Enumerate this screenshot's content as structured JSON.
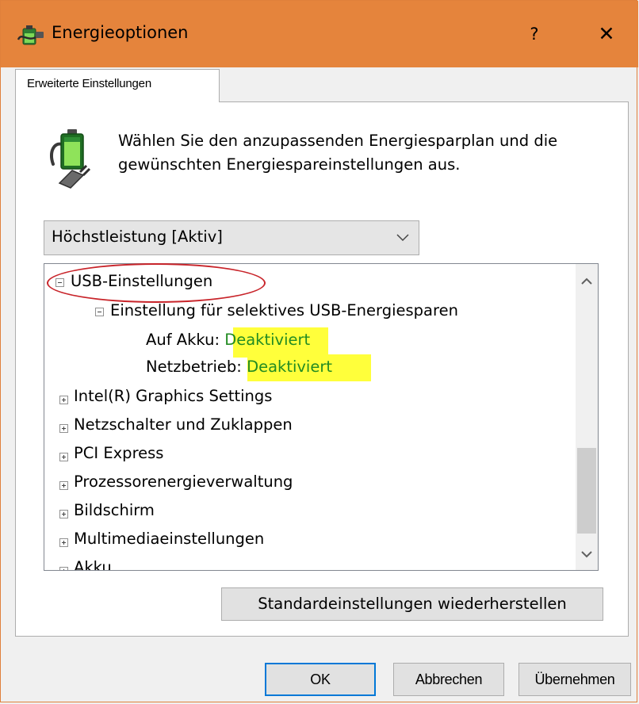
{
  "window": {
    "title": "Energieoptionen",
    "help_label": "?",
    "close_label": "✕",
    "title_bar_color": "#e5843c"
  },
  "tabs": [
    {
      "label": "Erweiterte Einstellungen",
      "selected": true
    }
  ],
  "description": "Wählen Sie den anzupassenden Energiesparplan und die gewünschten Energiespareinstellungen aus.",
  "plan_select": {
    "value": "Höchstleistung [Aktiv]"
  },
  "tree": {
    "usb": {
      "label": "USB-Einstellungen",
      "expanded": true,
      "child": {
        "label": "Einstellung für selektives USB-Energiesparen",
        "expanded": true,
        "settings": [
          {
            "label": "Auf Akku:",
            "value": "Deaktiviert"
          },
          {
            "label": "Netzbetrieb:",
            "value": "Deaktiviert"
          }
        ]
      }
    },
    "items": [
      {
        "label": "Intel(R) Graphics Settings"
      },
      {
        "label": "Netzschalter und Zuklappen"
      },
      {
        "label": "PCI Express"
      },
      {
        "label": "Prozessorenergieverwaltung"
      },
      {
        "label": "Bildschirm"
      },
      {
        "label": "Multimediaeinstellungen"
      },
      {
        "label": "Akku"
      }
    ],
    "value_color": "#228b22",
    "highlight_color": "#ffff3b",
    "annotation_color": "#c8242a"
  },
  "buttons": {
    "restore_defaults": "Standardeinstellungen wiederherstellen",
    "ok": "OK",
    "cancel": "Abbrechen",
    "apply": "Übernehmen"
  }
}
